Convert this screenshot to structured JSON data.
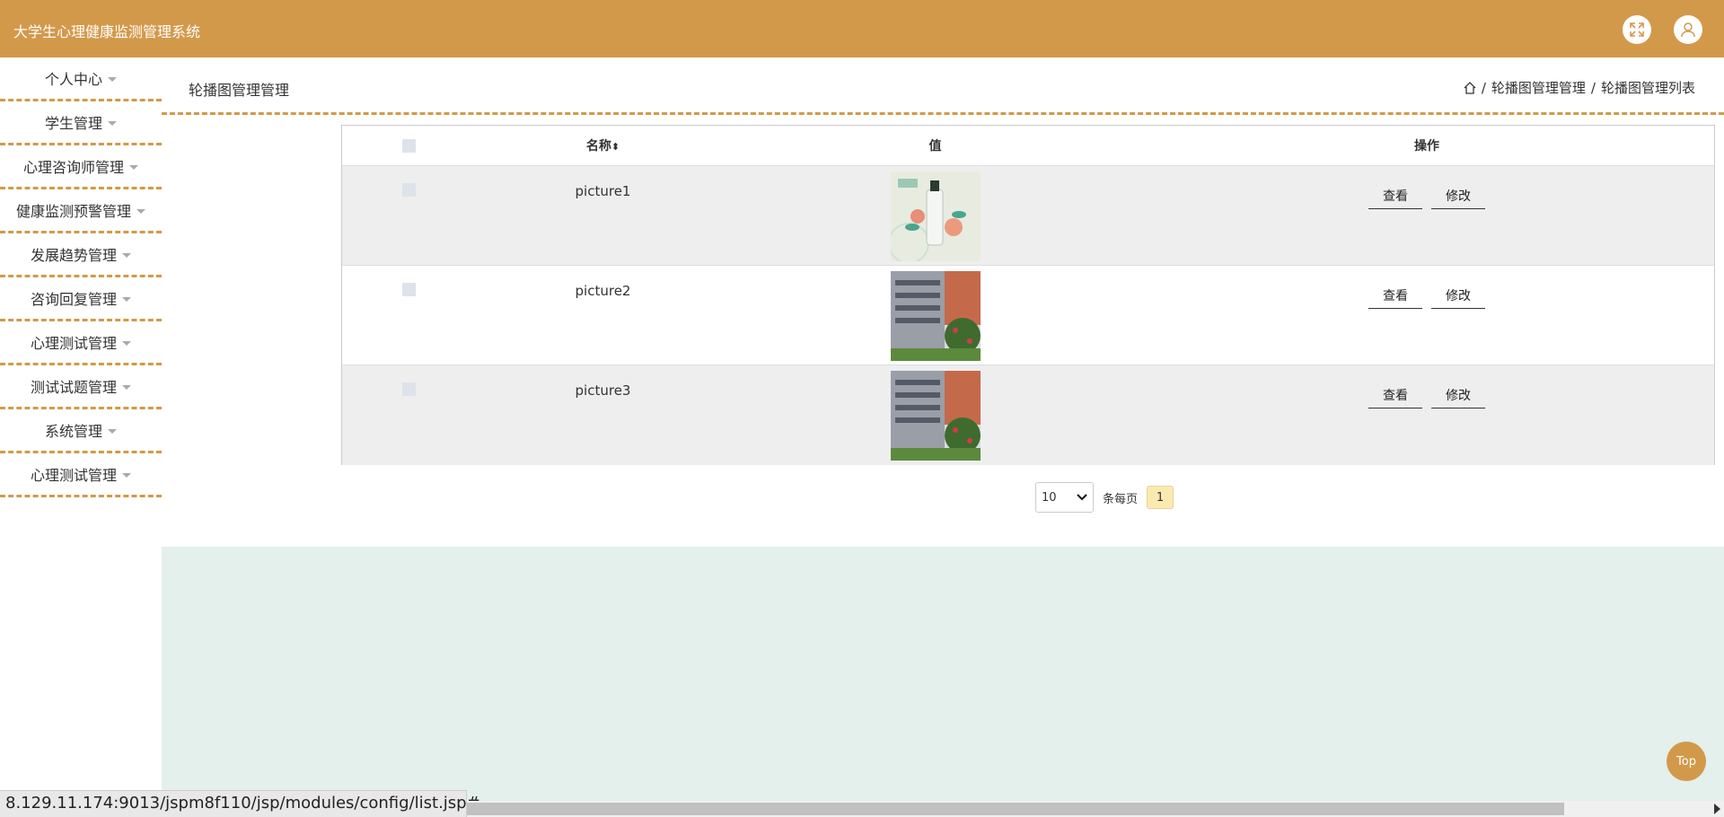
{
  "header": {
    "app_title": "大学生心理健康监测管理系统",
    "icons": [
      "fullscreen-icon",
      "user-icon"
    ],
    "color": "#d3994b"
  },
  "sidebar": {
    "items": [
      {
        "label": "个人中心"
      },
      {
        "label": "学生管理"
      },
      {
        "label": "心理咨询师管理"
      },
      {
        "label": "健康监测预警管理"
      },
      {
        "label": "发展趋势管理"
      },
      {
        "label": "咨询回复管理"
      },
      {
        "label": "心理测试管理"
      },
      {
        "label": "测试试题管理"
      },
      {
        "label": "系统管理"
      },
      {
        "label": "心理测试管理"
      }
    ]
  },
  "page": {
    "title": "轮播图管理管理",
    "breadcrumb": [
      "轮播图管理管理",
      "轮播图管理列表"
    ],
    "breadcrumb_sep": "/"
  },
  "table": {
    "columns": [
      "名称",
      "值",
      "操作"
    ],
    "sort_icon": "⬍",
    "rows": [
      {
        "name": "picture1",
        "view": "查看",
        "edit": "修改"
      },
      {
        "name": "picture2",
        "view": "查看",
        "edit": "修改"
      },
      {
        "name": "picture3",
        "view": "查看",
        "edit": "修改"
      }
    ]
  },
  "pagination": {
    "page_size": "10",
    "per_page_label": "条每页",
    "current_page": "1"
  },
  "top_button": "Top",
  "status_url": "8.129.11.174:9013/jspm8f110/jsp/modules/config/list.jsp#"
}
